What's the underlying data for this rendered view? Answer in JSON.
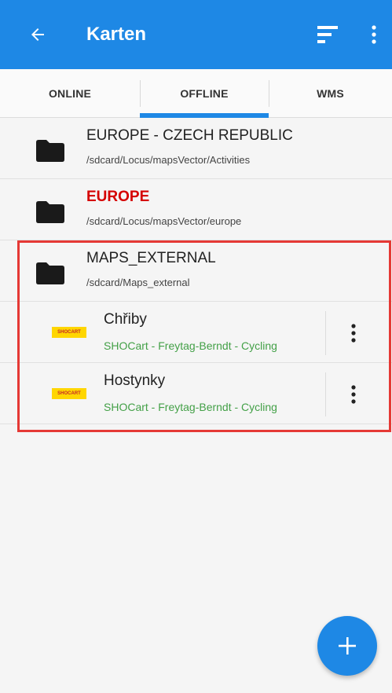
{
  "app_bar": {
    "title": "Karten",
    "back_icon": "arrow-left-icon",
    "sort_icon": "sort-icon",
    "more_icon": "more-vert-icon",
    "color": "#1e88e5"
  },
  "tabs": [
    {
      "label": "ONLINE",
      "selected": false
    },
    {
      "label": "OFFLINE",
      "selected": true
    },
    {
      "label": "WMS",
      "selected": false
    }
  ],
  "folders": [
    {
      "title": "EUROPE - CZECH REPUBLIC",
      "path": "/sdcard/Locus/mapsVector/Activities",
      "highlight": false
    },
    {
      "title": "EUROPE",
      "path": "/sdcard/Locus/mapsVector/europe",
      "highlight": true,
      "title_color": "#d50000"
    },
    {
      "title": "MAPS_EXTERNAL",
      "path": "/sdcard/Maps_external",
      "highlight": false
    }
  ],
  "maps": [
    {
      "title": "Chřiby",
      "subtitle": "SHOCart - Freytag-Berndt - Cycling",
      "logo_text": "SHOCART",
      "subtitle_color": "#43a047"
    },
    {
      "title": "Hostynky",
      "subtitle": "SHOCart - Freytag-Berndt - Cycling",
      "logo_text": "SHOCART",
      "subtitle_color": "#43a047"
    }
  ],
  "fab": {
    "icon": "plus-icon",
    "color": "#1e88e5"
  },
  "highlight_box": {
    "color": "#e53935"
  }
}
